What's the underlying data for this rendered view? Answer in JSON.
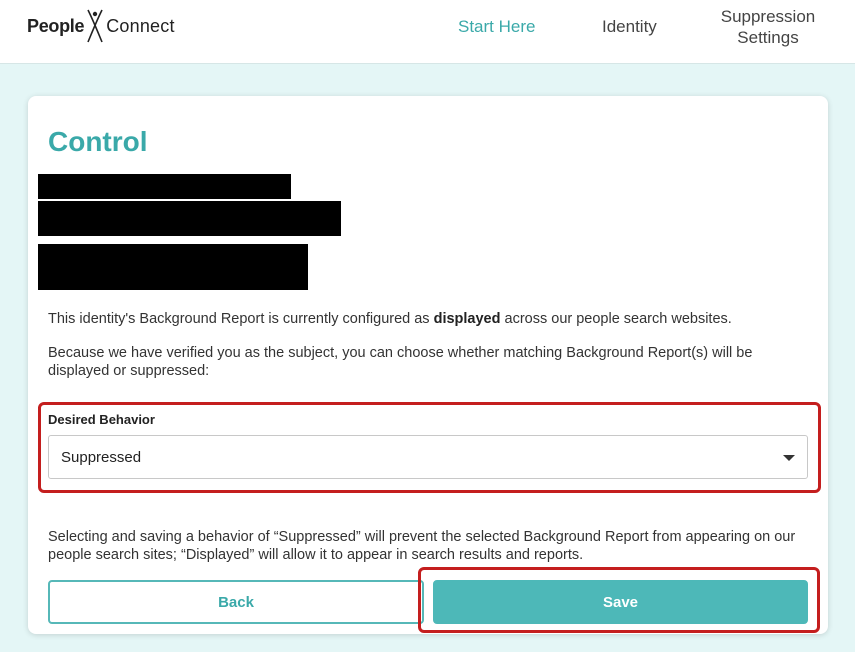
{
  "header": {
    "logo": {
      "people": "People",
      "connect": "Connect",
      "tm": "."
    },
    "nav": {
      "start_here": "Start Here",
      "identity": "Identity",
      "suppression_line1": "Suppression",
      "suppression_line2": "Settings"
    }
  },
  "card": {
    "title": "Control",
    "status_pre": "This identity's Background Report is currently configured as ",
    "status_value": "displayed",
    "status_post": " across our people search websites.",
    "instruction": "Because we have verified you as the subject, you can choose whether matching Background Report(s) will be displayed or suppressed:",
    "field_label": "Desired Behavior",
    "select_value": "Suppressed",
    "explanation": "Selecting and saving a behavior of “Suppressed” will prevent the selected Background Report from appearing on our people search sites; “Displayed” will allow it to appear in search results and reports.",
    "back_label": "Back",
    "save_label": "Save"
  },
  "colors": {
    "accent": "#3aa9a9",
    "save_button": "#4db8b8",
    "page_background": "#e4f6f6",
    "highlight": "#c41e1e"
  }
}
